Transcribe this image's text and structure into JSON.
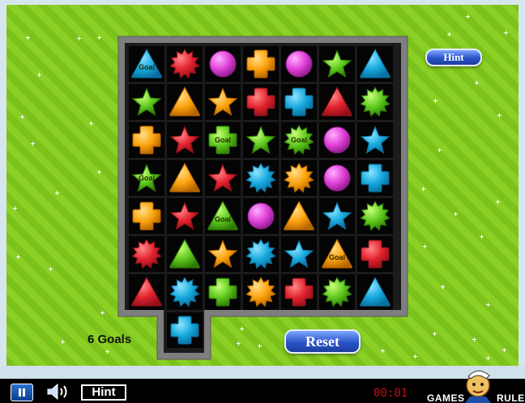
{
  "buttons": {
    "hint_top": "Hint",
    "reset": "Reset",
    "hint_bottom": "Hint"
  },
  "status": {
    "goals": "6 Goals",
    "timer": "00:01"
  },
  "logo": {
    "left": "GAMES",
    "right": "RULE"
  },
  "colors": {
    "background": "#8bd024",
    "frame": "#7e7e7e",
    "timer": "#c3121a",
    "button": "#2a53c8"
  },
  "board": {
    "rows": [
      [
        {
          "shape": "triangle",
          "color": "blue",
          "goal": "Goal"
        },
        {
          "shape": "burst",
          "color": "red"
        },
        {
          "shape": "circle",
          "color": "purple"
        },
        {
          "shape": "cross",
          "color": "orange"
        },
        {
          "shape": "circle",
          "color": "purple"
        },
        {
          "shape": "star",
          "color": "green"
        },
        {
          "shape": "triangle",
          "color": "blue"
        }
      ],
      [
        {
          "shape": "star",
          "color": "green"
        },
        {
          "shape": "triangle",
          "color": "orange"
        },
        {
          "shape": "star",
          "color": "orange"
        },
        {
          "shape": "cross",
          "color": "red"
        },
        {
          "shape": "cross",
          "color": "blue"
        },
        {
          "shape": "triangle",
          "color": "red"
        },
        {
          "shape": "burst",
          "color": "green"
        }
      ],
      [
        {
          "shape": "cross",
          "color": "orange"
        },
        {
          "shape": "star",
          "color": "red"
        },
        {
          "shape": "cross",
          "color": "green",
          "goal": "Goal"
        },
        {
          "shape": "star",
          "color": "green"
        },
        {
          "shape": "burst",
          "color": "green",
          "goal": "Goal"
        },
        {
          "shape": "circle",
          "color": "purple"
        },
        {
          "shape": "star",
          "color": "blue"
        }
      ],
      [
        {
          "shape": "star",
          "color": "green",
          "goal": "Goal"
        },
        {
          "shape": "triangle",
          "color": "orange"
        },
        {
          "shape": "star",
          "color": "red"
        },
        {
          "shape": "burst",
          "color": "blue"
        },
        {
          "shape": "burst",
          "color": "orange"
        },
        {
          "shape": "circle",
          "color": "purple"
        },
        {
          "shape": "cross",
          "color": "blue"
        }
      ],
      [
        {
          "shape": "cross",
          "color": "orange"
        },
        {
          "shape": "star",
          "color": "red"
        },
        {
          "shape": "triangle",
          "color": "green",
          "goal": "Goal"
        },
        {
          "shape": "circle",
          "color": "purple"
        },
        {
          "shape": "triangle",
          "color": "orange"
        },
        {
          "shape": "star",
          "color": "blue"
        },
        {
          "shape": "burst",
          "color": "green"
        }
      ],
      [
        {
          "shape": "burst",
          "color": "red"
        },
        {
          "shape": "triangle",
          "color": "green"
        },
        {
          "shape": "star",
          "color": "orange"
        },
        {
          "shape": "burst",
          "color": "blue"
        },
        {
          "shape": "star",
          "color": "blue"
        },
        {
          "shape": "triangle",
          "color": "orange",
          "goal": "Goal"
        },
        {
          "shape": "cross",
          "color": "red"
        }
      ],
      [
        {
          "shape": "triangle",
          "color": "red"
        },
        {
          "shape": "burst",
          "color": "blue"
        },
        {
          "shape": "cross",
          "color": "green"
        },
        {
          "shape": "burst",
          "color": "orange"
        },
        {
          "shape": "cross",
          "color": "red"
        },
        {
          "shape": "burst",
          "color": "green"
        },
        {
          "shape": "triangle",
          "color": "blue"
        }
      ],
      [
        null,
        {
          "shape": "cross",
          "color": "blue"
        },
        null,
        null,
        null,
        null,
        null
      ]
    ]
  }
}
